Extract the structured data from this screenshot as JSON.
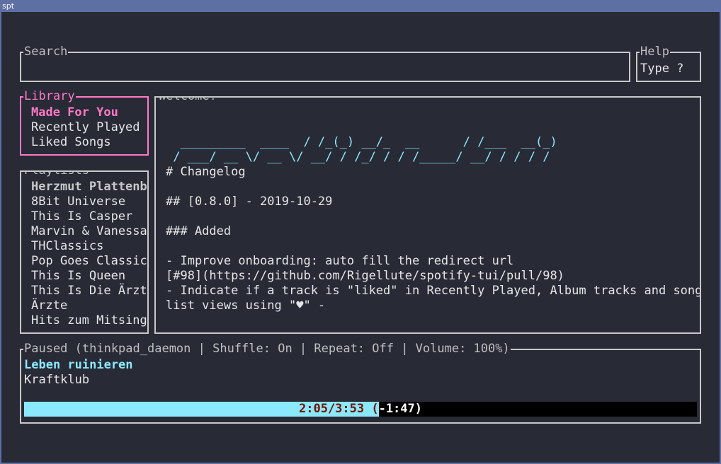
{
  "window": {
    "title": "spt"
  },
  "search": {
    "title": "Search",
    "value": ""
  },
  "help": {
    "title": "Help",
    "hint": "Type ?"
  },
  "library": {
    "title": "Library",
    "items": [
      "Made For You",
      "Recently Played",
      "Liked Songs"
    ]
  },
  "playlists": {
    "title": "Playlists",
    "items": [
      "Herzmut Plattenb",
      "8Bit Universe",
      "This Is Casper",
      "Marvin & Vanessa",
      "THClassics",
      "Pop Goes Classic",
      "This Is Queen",
      "This Is Die Ärzt",
      "Ärzte",
      "Hits zum Mitsing"
    ]
  },
  "welcome": {
    "title": "Welcome!",
    "ascii": [
      "  _________  ____  / /_(_) __/_  __      / /___  __(_)",
      " / ___/ __ \\/ __ \\/ __/ / /_/ / / /_____/ __/ / / / /"
    ],
    "lines": [
      "# Changelog",
      "",
      "## [0.8.0] - 2019-10-29",
      "",
      "### Added",
      "",
      "- Improve onboarding: auto fill the redirect url",
      "[#98](https://github.com/Rigellute/spotify-tui/pull/98)",
      "- Indicate if a track is \"liked\" in Recently Played, Album tracks and song",
      "list views using \"♥\" -"
    ]
  },
  "player": {
    "title": "Paused (thinkpad_daemon | Shuffle: On | Repeat: Off | Volume: 100%)",
    "track": "Leben ruinieren",
    "artist": "Kraftklub",
    "progress_label": "2:05/3:53 (-1:47)",
    "progress_fraction": 0.527,
    "colors": {
      "accent": "#8be9fd",
      "active_border": "#ff79c6"
    }
  }
}
